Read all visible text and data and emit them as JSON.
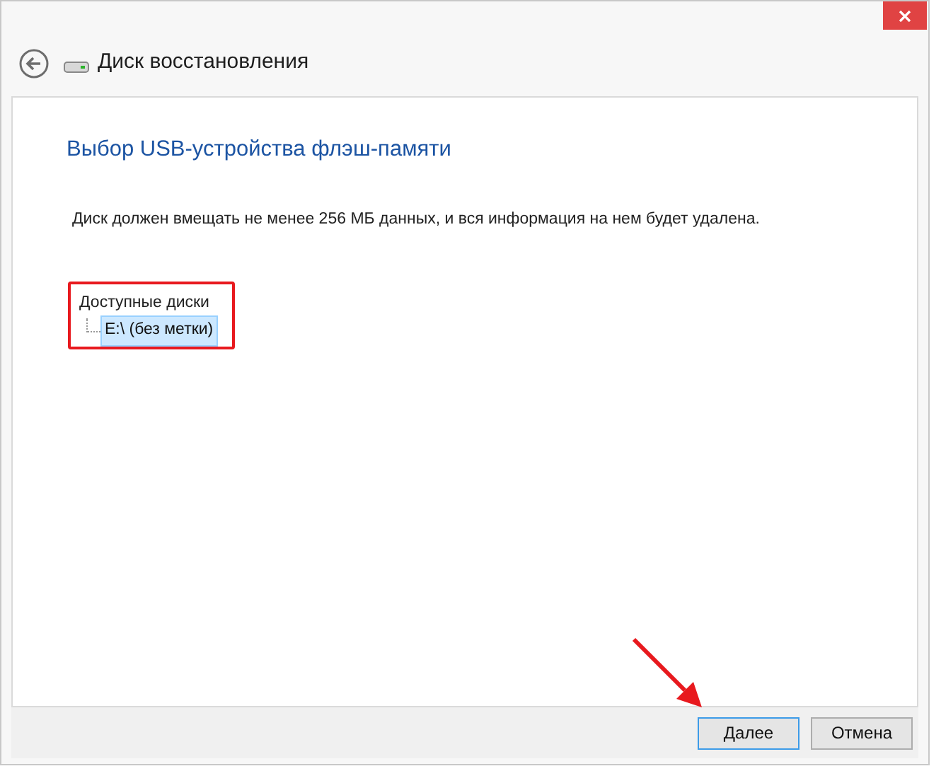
{
  "window": {
    "title": "Диск восстановления"
  },
  "heading": "Выбор USB-устройства флэш-памяти",
  "description": "Диск должен вмещать не менее 256 МБ данных, и вся информация на нем будет удалена.",
  "drive_tree": {
    "label": "Доступные диски",
    "items": [
      {
        "label": "E:\\ (без метки)",
        "selected": true
      }
    ]
  },
  "buttons": [
    {
      "label": "Далее",
      "focused": true
    },
    {
      "label": "Отмена",
      "focused": false
    }
  ]
}
